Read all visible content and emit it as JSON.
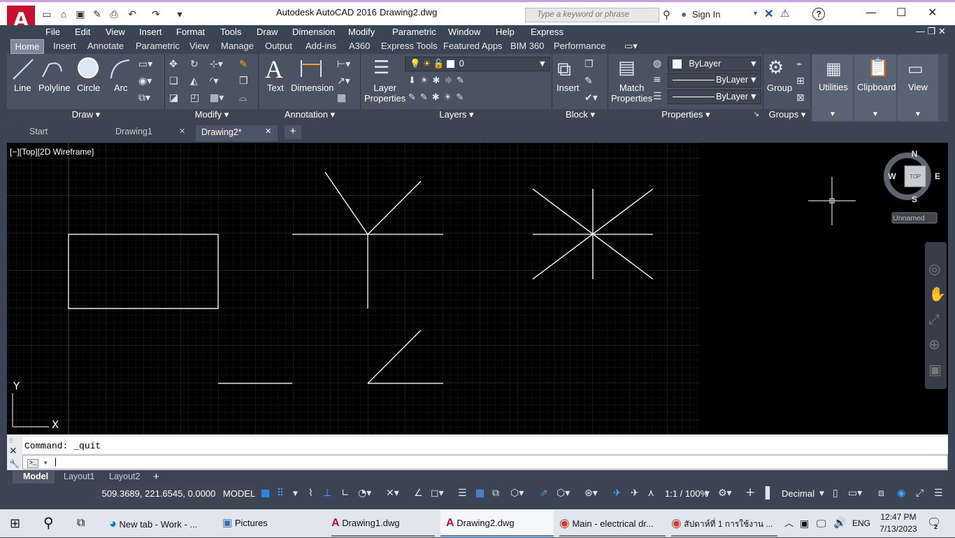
{
  "app": {
    "title": "Autodesk AutoCAD 2016",
    "document": "Drawing2.dwg",
    "logo": "A",
    "search_placeholder": "Type a keyword or phrase",
    "sign_in": "Sign In"
  },
  "menus": [
    "File",
    "Edit",
    "View",
    "Insert",
    "Format",
    "Tools",
    "Draw",
    "Dimension",
    "Modify",
    "Parametric",
    "Window",
    "Help",
    "Express"
  ],
  "ribbon_tabs": [
    "Home",
    "Insert",
    "Annotate",
    "Parametric",
    "View",
    "Manage",
    "Output",
    "Add-ins",
    "A360",
    "Express Tools",
    "Featured Apps",
    "BIM 360",
    "Performance"
  ],
  "active_ribbon_tab": "Home",
  "ribbon": {
    "draw": {
      "title": "Draw",
      "tools": [
        "Line",
        "Polyline",
        "Circle",
        "Arc"
      ]
    },
    "modify": {
      "title": "Modify"
    },
    "annotation": {
      "title": "Annotation",
      "tools": [
        "Text",
        "Dimension"
      ]
    },
    "layers": {
      "title": "Layers",
      "tool_line1": "Layer",
      "tool_line2": "Properties",
      "layer_value": "0"
    },
    "block": {
      "title": "Block",
      "tool": "Insert"
    },
    "properties": {
      "title": "Properties",
      "tool_line1": "Match",
      "tool_line2": "Properties",
      "color": "ByLayer",
      "linetype": "ByLayer",
      "lineweight": "ByLayer"
    },
    "groups": {
      "title": "Groups",
      "tool": "Group"
    },
    "utilities": {
      "tool": "Utilities"
    },
    "clipboard": {
      "tool": "Clipboard"
    },
    "view": {
      "tool": "View"
    }
  },
  "doc_tabs": [
    "Start",
    "Drawing1",
    "Drawing2*"
  ],
  "viewport_label": "[−][Top][2D Wireframe]",
  "viewcube": {
    "n": "N",
    "s": "S",
    "e": "E",
    "w": "W",
    "face": "TOP",
    "ucs": "Unnamed"
  },
  "ucs_axes": {
    "x": "X",
    "y": "Y"
  },
  "command": {
    "history": "Command: _quit",
    "prompt": ""
  },
  "layout_tabs": [
    "Model",
    "Layout1",
    "Layout2"
  ],
  "status": {
    "coords": "509.3689, 221.6545, 0.0000",
    "space": "MODEL",
    "scale": "1:1 / 100%",
    "units": "Decimal"
  },
  "taskbar": {
    "items": [
      "New tab - Work - ...",
      "Pictures",
      "Drawing1.dwg",
      "Drawing2.dwg",
      "Main - electrical dr...",
      "สัปดาห์ที่ 1 การใช้งาน ..."
    ],
    "lang": "ENG",
    "time": "12:47 PM",
    "date": "7/13/2023",
    "notifications": "2"
  }
}
